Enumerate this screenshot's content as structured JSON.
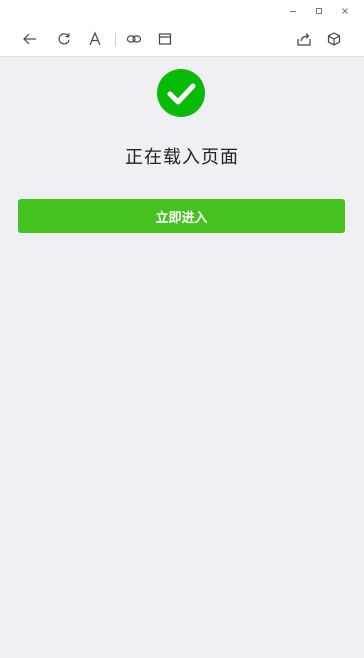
{
  "window": {
    "controls": [
      {
        "name": "minimize-icon"
      },
      {
        "name": "maximize-icon"
      },
      {
        "name": "close-icon"
      }
    ]
  },
  "toolbar": {
    "icons": [
      {
        "name": "back-arrow-icon"
      },
      {
        "name": "refresh-icon"
      },
      {
        "name": "font-size-icon"
      },
      {
        "name": "link-icon"
      },
      {
        "name": "window-icon"
      },
      {
        "name": "share-icon"
      },
      {
        "name": "cube-icon"
      }
    ]
  },
  "main": {
    "status_text": "正在载入页面",
    "enter_button_label": "立即进入"
  },
  "colors": {
    "accent": "#44c21f",
    "success_icon": "#09bb07",
    "page_background": "#efeff4",
    "toolbar_background": "#ffffff",
    "status_text": "#222222"
  }
}
